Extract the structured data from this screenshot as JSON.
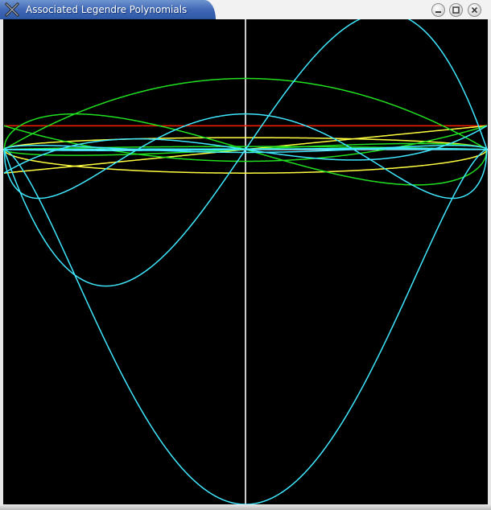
{
  "window": {
    "title": "Associated Legendre Polynomials",
    "icon": "x-window-icon",
    "controls": [
      "minimize-icon",
      "maximize-icon",
      "close-icon"
    ]
  },
  "colors": {
    "background": "#000000",
    "axis": "#ffffff",
    "l0": "#ff2000",
    "l1": "#ffff40",
    "l2": "#20e020",
    "l3": "#40e8ff"
  },
  "chart_data": {
    "type": "line",
    "title": "",
    "xlabel": "",
    "ylabel": "",
    "xlim": [
      -1,
      1
    ],
    "ylim": [
      -15,
      5.5
    ],
    "grid": false,
    "legend": "none",
    "series": [
      {
        "color": "red",
        "l": 0,
        "m": 0
      },
      {
        "color": "yellow",
        "l": 1,
        "m": 0
      },
      {
        "color": "yellow",
        "l": 1,
        "m": 1
      },
      {
        "color": "yellow",
        "l": 1,
        "m": -1
      },
      {
        "color": "green",
        "l": 2,
        "m": 0
      },
      {
        "color": "green",
        "l": 2,
        "m": 1
      },
      {
        "color": "green",
        "l": 2,
        "m": 2
      },
      {
        "color": "green",
        "l": 2,
        "m": -1
      },
      {
        "color": "green",
        "l": 2,
        "m": -2
      },
      {
        "color": "cyan",
        "l": 3,
        "m": 0
      },
      {
        "color": "cyan",
        "l": 3,
        "m": 1
      },
      {
        "color": "cyan",
        "l": 3,
        "m": 2
      },
      {
        "color": "cyan",
        "l": 3,
        "m": 3
      },
      {
        "color": "cyan",
        "l": 3,
        "m": -1
      },
      {
        "color": "cyan",
        "l": 3,
        "m": -2
      },
      {
        "color": "cyan",
        "l": 3,
        "m": -3
      }
    ]
  }
}
